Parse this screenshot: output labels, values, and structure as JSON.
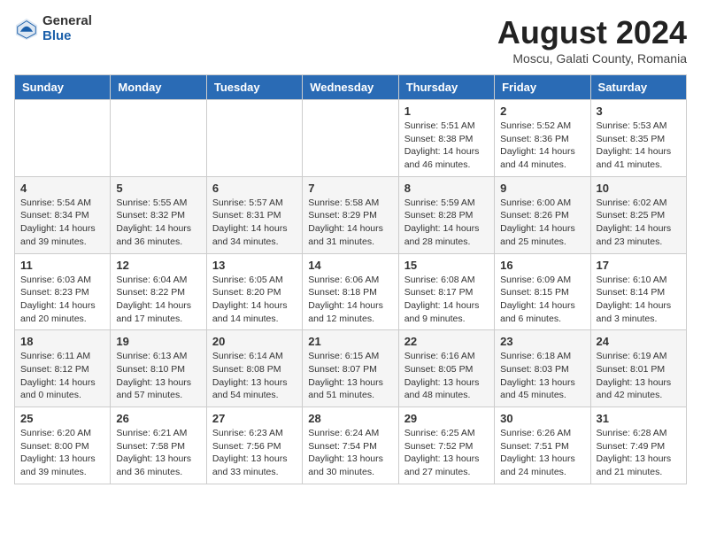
{
  "logo": {
    "general": "General",
    "blue": "Blue"
  },
  "header": {
    "month_year": "August 2024",
    "location": "Moscu, Galati County, Romania"
  },
  "days_of_week": [
    "Sunday",
    "Monday",
    "Tuesday",
    "Wednesday",
    "Thursday",
    "Friday",
    "Saturday"
  ],
  "weeks": [
    [
      {
        "day": "",
        "info": ""
      },
      {
        "day": "",
        "info": ""
      },
      {
        "day": "",
        "info": ""
      },
      {
        "day": "",
        "info": ""
      },
      {
        "day": "1",
        "info": "Sunrise: 5:51 AM\nSunset: 8:38 PM\nDaylight: 14 hours and 46 minutes."
      },
      {
        "day": "2",
        "info": "Sunrise: 5:52 AM\nSunset: 8:36 PM\nDaylight: 14 hours and 44 minutes."
      },
      {
        "day": "3",
        "info": "Sunrise: 5:53 AM\nSunset: 8:35 PM\nDaylight: 14 hours and 41 minutes."
      }
    ],
    [
      {
        "day": "4",
        "info": "Sunrise: 5:54 AM\nSunset: 8:34 PM\nDaylight: 14 hours and 39 minutes."
      },
      {
        "day": "5",
        "info": "Sunrise: 5:55 AM\nSunset: 8:32 PM\nDaylight: 14 hours and 36 minutes."
      },
      {
        "day": "6",
        "info": "Sunrise: 5:57 AM\nSunset: 8:31 PM\nDaylight: 14 hours and 34 minutes."
      },
      {
        "day": "7",
        "info": "Sunrise: 5:58 AM\nSunset: 8:29 PM\nDaylight: 14 hours and 31 minutes."
      },
      {
        "day": "8",
        "info": "Sunrise: 5:59 AM\nSunset: 8:28 PM\nDaylight: 14 hours and 28 minutes."
      },
      {
        "day": "9",
        "info": "Sunrise: 6:00 AM\nSunset: 8:26 PM\nDaylight: 14 hours and 25 minutes."
      },
      {
        "day": "10",
        "info": "Sunrise: 6:02 AM\nSunset: 8:25 PM\nDaylight: 14 hours and 23 minutes."
      }
    ],
    [
      {
        "day": "11",
        "info": "Sunrise: 6:03 AM\nSunset: 8:23 PM\nDaylight: 14 hours and 20 minutes."
      },
      {
        "day": "12",
        "info": "Sunrise: 6:04 AM\nSunset: 8:22 PM\nDaylight: 14 hours and 17 minutes."
      },
      {
        "day": "13",
        "info": "Sunrise: 6:05 AM\nSunset: 8:20 PM\nDaylight: 14 hours and 14 minutes."
      },
      {
        "day": "14",
        "info": "Sunrise: 6:06 AM\nSunset: 8:18 PM\nDaylight: 14 hours and 12 minutes."
      },
      {
        "day": "15",
        "info": "Sunrise: 6:08 AM\nSunset: 8:17 PM\nDaylight: 14 hours and 9 minutes."
      },
      {
        "day": "16",
        "info": "Sunrise: 6:09 AM\nSunset: 8:15 PM\nDaylight: 14 hours and 6 minutes."
      },
      {
        "day": "17",
        "info": "Sunrise: 6:10 AM\nSunset: 8:14 PM\nDaylight: 14 hours and 3 minutes."
      }
    ],
    [
      {
        "day": "18",
        "info": "Sunrise: 6:11 AM\nSunset: 8:12 PM\nDaylight: 14 hours and 0 minutes."
      },
      {
        "day": "19",
        "info": "Sunrise: 6:13 AM\nSunset: 8:10 PM\nDaylight: 13 hours and 57 minutes."
      },
      {
        "day": "20",
        "info": "Sunrise: 6:14 AM\nSunset: 8:08 PM\nDaylight: 13 hours and 54 minutes."
      },
      {
        "day": "21",
        "info": "Sunrise: 6:15 AM\nSunset: 8:07 PM\nDaylight: 13 hours and 51 minutes."
      },
      {
        "day": "22",
        "info": "Sunrise: 6:16 AM\nSunset: 8:05 PM\nDaylight: 13 hours and 48 minutes."
      },
      {
        "day": "23",
        "info": "Sunrise: 6:18 AM\nSunset: 8:03 PM\nDaylight: 13 hours and 45 minutes."
      },
      {
        "day": "24",
        "info": "Sunrise: 6:19 AM\nSunset: 8:01 PM\nDaylight: 13 hours and 42 minutes."
      }
    ],
    [
      {
        "day": "25",
        "info": "Sunrise: 6:20 AM\nSunset: 8:00 PM\nDaylight: 13 hours and 39 minutes."
      },
      {
        "day": "26",
        "info": "Sunrise: 6:21 AM\nSunset: 7:58 PM\nDaylight: 13 hours and 36 minutes."
      },
      {
        "day": "27",
        "info": "Sunrise: 6:23 AM\nSunset: 7:56 PM\nDaylight: 13 hours and 33 minutes."
      },
      {
        "day": "28",
        "info": "Sunrise: 6:24 AM\nSunset: 7:54 PM\nDaylight: 13 hours and 30 minutes."
      },
      {
        "day": "29",
        "info": "Sunrise: 6:25 AM\nSunset: 7:52 PM\nDaylight: 13 hours and 27 minutes."
      },
      {
        "day": "30",
        "info": "Sunrise: 6:26 AM\nSunset: 7:51 PM\nDaylight: 13 hours and 24 minutes."
      },
      {
        "day": "31",
        "info": "Sunrise: 6:28 AM\nSunset: 7:49 PM\nDaylight: 13 hours and 21 minutes."
      }
    ]
  ]
}
